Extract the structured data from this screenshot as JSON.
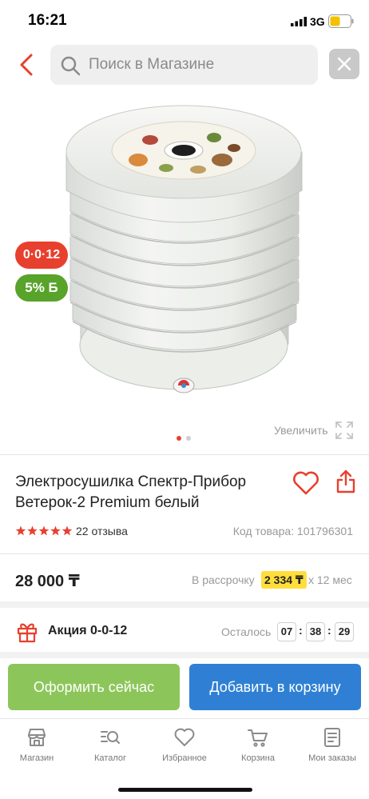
{
  "status_bar": {
    "time": "16:21",
    "network": "3G"
  },
  "search": {
    "placeholder": "Поиск в Магазине"
  },
  "gallery": {
    "badges": {
      "promo": "0·0·12",
      "bonus": "5% Б"
    },
    "zoom_label": "Увеличить",
    "slide_count": 2,
    "active_slide": 1
  },
  "product": {
    "title": "Электросушилка Спектр-Прибор Ветерок-2 Premium белый",
    "rating_stars": 5,
    "reviews": "22 отзыва",
    "code": "Код товара: 101796301",
    "price": "28 000 ₸",
    "installment": {
      "label": "В рассрочку",
      "amount": "2 334 ₸",
      "term": "х 12 мес"
    }
  },
  "promo": {
    "label": "Акция 0-0-12",
    "remaining_label": "Осталось",
    "timer": [
      "07",
      "38",
      "29"
    ]
  },
  "actions": {
    "buy_now": "Оформить сейчас",
    "add_to_cart": "Добавить в корзину"
  },
  "tabs": [
    {
      "label": "Магазин",
      "icon": "store-icon"
    },
    {
      "label": "Каталог",
      "icon": "catalog-search-icon"
    },
    {
      "label": "Избранное",
      "icon": "heart-icon"
    },
    {
      "label": "Корзина",
      "icon": "cart-icon"
    },
    {
      "label": "Мои заказы",
      "icon": "orders-icon"
    }
  ],
  "colors": {
    "accent_red": "#e8402e",
    "bonus_green": "#58a32a",
    "buy_green": "#8cc65a",
    "cart_blue": "#2f80d4",
    "installment_yellow": "#ffde3b"
  }
}
